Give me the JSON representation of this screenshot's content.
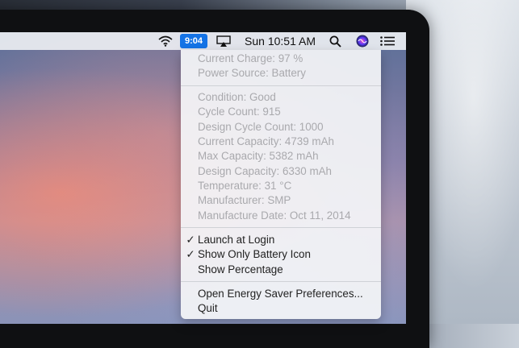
{
  "menubar": {
    "battery_label": "9:04",
    "clock": "Sun 10:51 AM",
    "icons": [
      "wifi-icon",
      "battery-icon",
      "airplay-icon",
      "search-icon",
      "siri-icon",
      "notification-center-icon"
    ]
  },
  "menu": {
    "info": [
      "Current Charge: 97 %",
      "Power Source: Battery"
    ],
    "details": [
      "Condition: Good",
      "Cycle Count: 915",
      "Design Cycle Count: 1000",
      "Current Capacity: 4739 mAh",
      "Max Capacity: 5382 mAh",
      "Design Capacity: 6330 mAh",
      "Temperature: 31 °C",
      "Manufacturer: SMP",
      "Manufacture Date: Oct 11, 2014"
    ],
    "options": [
      {
        "label": "Launch at Login",
        "check": "✓"
      },
      {
        "label": "Show Only Battery Icon",
        "check": "✓"
      },
      {
        "label": "Show Percentage",
        "check": ""
      }
    ],
    "actions": [
      "Open Energy Saver Preferences...",
      "Quit"
    ]
  },
  "colors": {
    "highlight": "#1473e6",
    "disabled_text": "#a9a9ad",
    "menu_bg": "#f4f5f8"
  }
}
